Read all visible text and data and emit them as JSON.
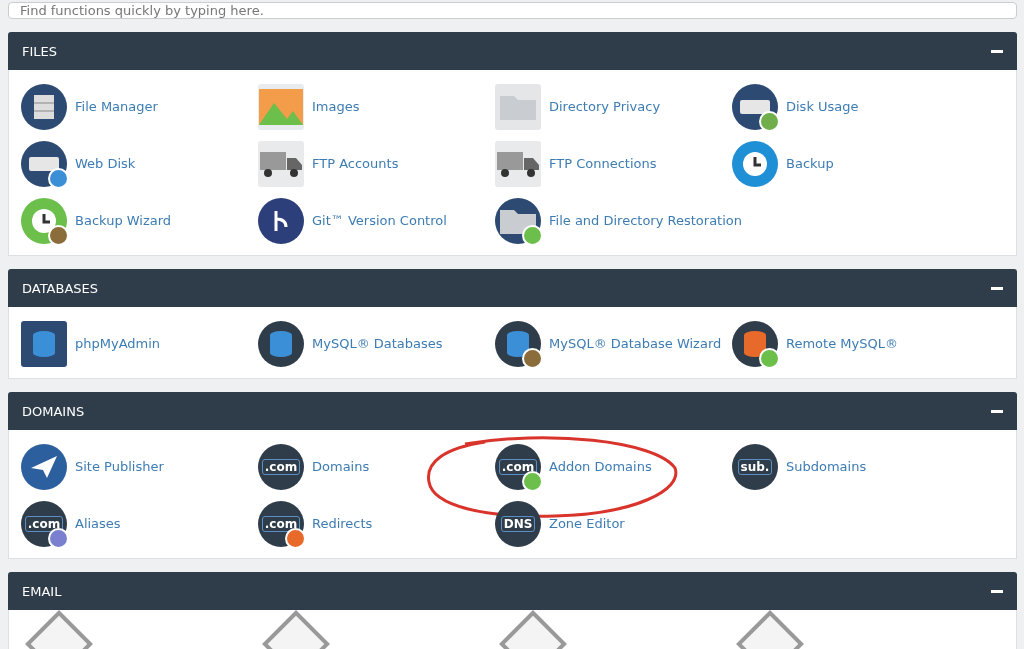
{
  "search": {
    "placeholder": "Find functions quickly by typing here."
  },
  "sections": [
    {
      "title": "FILES",
      "expanded": true,
      "items": [
        {
          "label": "File Manager"
        },
        {
          "label": "Images"
        },
        {
          "label": "Directory Privacy"
        },
        {
          "label": "Disk Usage"
        },
        {
          "label": "Web Disk"
        },
        {
          "label": "FTP Accounts"
        },
        {
          "label": "FTP Connections"
        },
        {
          "label": "Backup"
        },
        {
          "label": "Backup Wizard"
        },
        {
          "label": "Git™ Version Control"
        },
        {
          "label": "File and Directory Restoration"
        }
      ]
    },
    {
      "title": "DATABASES",
      "expanded": true,
      "items": [
        {
          "label": "phpMyAdmin"
        },
        {
          "label": "MySQL® Databases"
        },
        {
          "label": "MySQL® Database Wizard"
        },
        {
          "label": "Remote MySQL®"
        }
      ]
    },
    {
      "title": "DOMAINS",
      "expanded": true,
      "items": [
        {
          "label": "Site Publisher"
        },
        {
          "label": "Domains",
          "icon_text": ".com"
        },
        {
          "label": "Addon Domains",
          "icon_text": ".com",
          "circled": true
        },
        {
          "label": "Subdomains",
          "icon_text": "sub."
        },
        {
          "label": "Aliases",
          "icon_text": ".com"
        },
        {
          "label": "Redirects",
          "icon_text": ".com"
        },
        {
          "label": "Zone Editor",
          "icon_text": "DNS"
        }
      ]
    },
    {
      "title": "EMAIL",
      "expanded": true,
      "kind": "cut_off",
      "items": [
        {
          "kind": "cut_icon"
        },
        {
          "kind": "cut_icon"
        },
        {
          "kind": "cut_icon"
        },
        {
          "kind": "cut_icon"
        }
      ]
    }
  ]
}
